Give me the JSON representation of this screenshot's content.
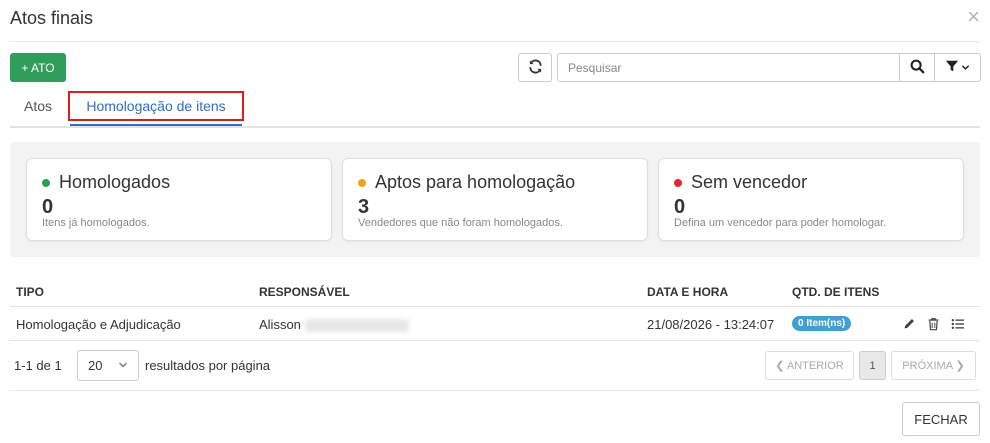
{
  "modal": {
    "title": "Atos finais",
    "close_glyph": "×",
    "icons": {
      "close": "close-icon",
      "refresh": "refresh-icon",
      "search": "search-icon",
      "filter": "filter-icon",
      "edit": "pencil-icon",
      "delete": "trash-icon",
      "list": "list-icon"
    }
  },
  "toolbar": {
    "add_label": "+ ATO",
    "search": {
      "placeholder": "Pesquisar",
      "value": ""
    }
  },
  "tabs": [
    {
      "label": "Atos",
      "active": false
    },
    {
      "label": "Homologação de itens",
      "active": true
    }
  ],
  "cards": [
    {
      "title": "Homologados",
      "count": "0",
      "description": "Itens já homologados.",
      "color": "#2e9e4f"
    },
    {
      "title": "Aptos para homologação",
      "count": "3",
      "description": "Vendedores que não foram homologados.",
      "color": "#f0a21b"
    },
    {
      "title": "Sem vencedor",
      "count": "0",
      "description": "Defina um vencedor para poder homologar.",
      "color": "#e0292c"
    }
  ],
  "table": {
    "columns": [
      "TIPO",
      "RESPONSÁVEL",
      "DATA E HORA",
      "QTD. DE ITENS"
    ],
    "rows": [
      {
        "tipo": "Homologação e Adjudicação",
        "responsavel": "Alisson",
        "data_hora": "21/08/2026 - 13:24:07",
        "qtd": "0 Item(ns)"
      }
    ]
  },
  "pagination": {
    "range": "1-1 de 1",
    "per_page": "20",
    "per_page_label": "resultados por página",
    "prev": "❮ ANTERIOR",
    "current": "1",
    "next": "PRÓXIMA ❯"
  },
  "footer": {
    "close_label": "FECHAR"
  },
  "colors": {
    "primary_green": "#2e9e5a",
    "tab_blue": "#2e6fbf",
    "highlight_red": "#e01b1b",
    "badge_blue": "#3fa0d5"
  }
}
